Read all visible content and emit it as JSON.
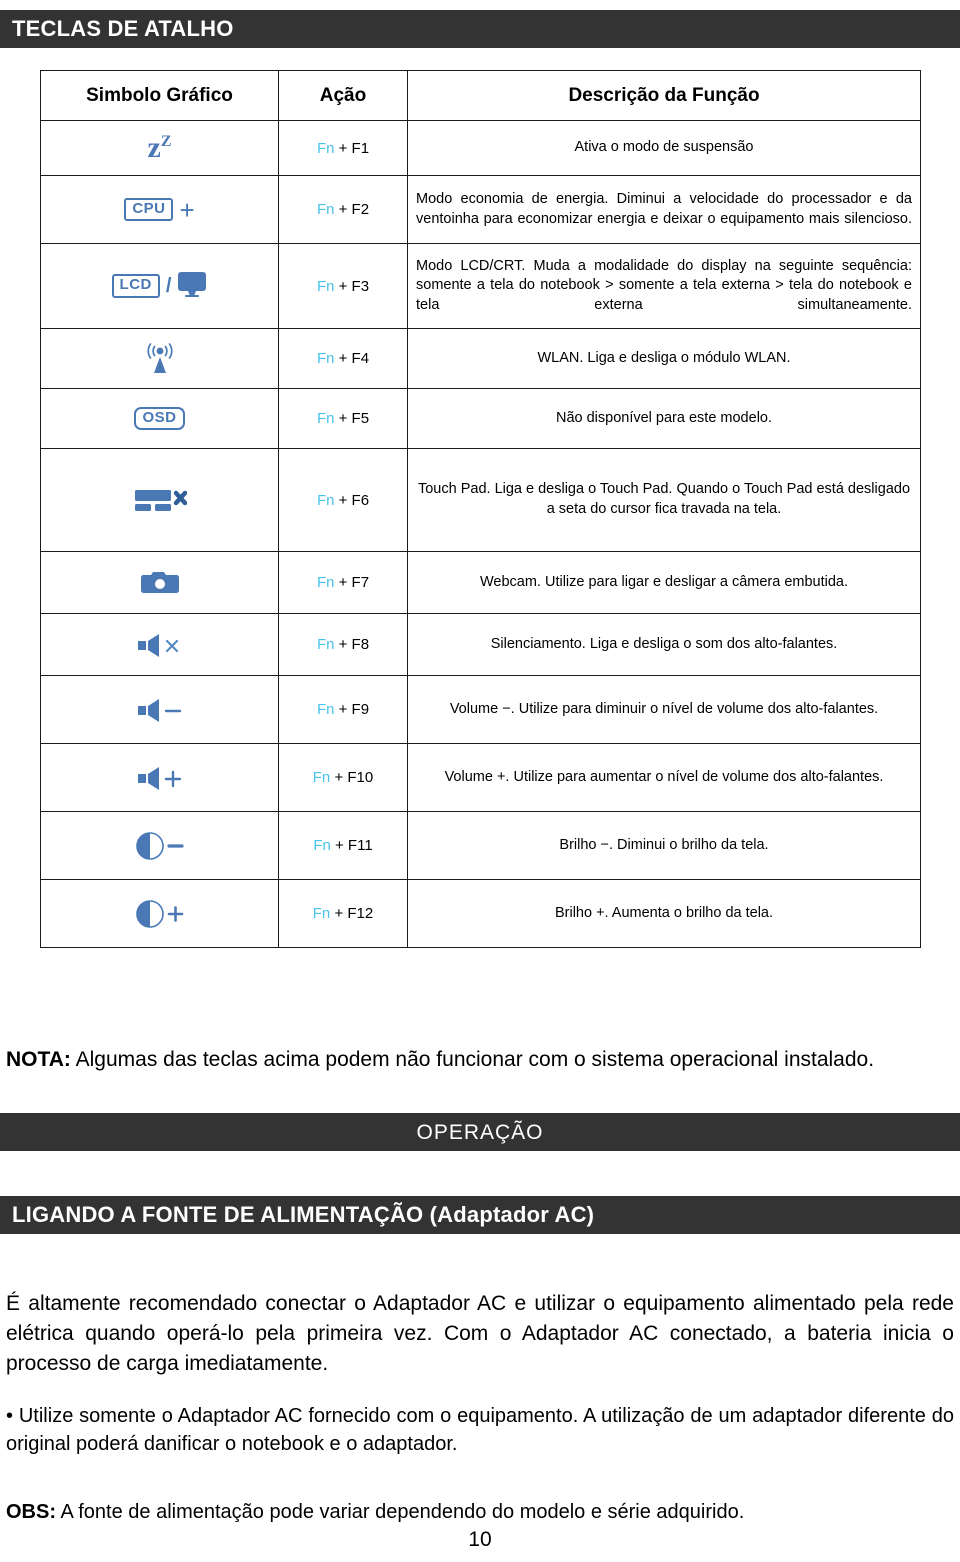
{
  "sections": {
    "top_bar_title": "TECLAS DE ATALHO",
    "operacao_bar_title": "OPERAÇÃO",
    "ligando_bar_title": "LIGANDO A FONTE DE ALIMENTAÇÃO (Adaptador AC)"
  },
  "table": {
    "headers": {
      "symbol": "Simbolo Gráfico",
      "action": "Ação",
      "description": "Descrição da Função"
    },
    "rows": [
      {
        "icon": "sleep-zz-icon",
        "fn": "Fn",
        "key": " + F1",
        "description": "Ativa o modo de suspensão"
      },
      {
        "icon": "cpu-plus-icon",
        "fn": "Fn",
        "key": " + F2",
        "description": "Modo economia de energia. Diminui a velocidade do processador e da ventoinha para economizar energia e deixar o equipamento mais silencioso."
      },
      {
        "icon": "lcd-monitor-icon",
        "fn": "Fn",
        "key": " + F3",
        "description": "Modo LCD/CRT. Muda a modalidade do display na seguinte sequência: somente a tela do notebook > somente a tela externa > tela do notebook e tela externa simultaneamente."
      },
      {
        "icon": "wlan-antenna-icon",
        "fn": "Fn",
        "key": " + F4",
        "description": "WLAN. Liga e desliga o módulo WLAN."
      },
      {
        "icon": "osd-icon",
        "fn": "Fn",
        "key": " + F5",
        "description": "Não disponível para este modelo."
      },
      {
        "icon": "touchpad-off-icon",
        "fn": "Fn",
        "key": " + F6",
        "description": "Touch Pad. Liga e desliga o Touch Pad. Quando o Touch Pad está desligado a seta do cursor fica travada na tela."
      },
      {
        "icon": "webcam-camera-icon",
        "fn": "Fn",
        "key": " + F7",
        "description": "Webcam. Utilize para ligar e desligar a câmera embutida."
      },
      {
        "icon": "speaker-mute-icon",
        "fn": "Fn",
        "key": " + F8",
        "description": "Silenciamento. Liga e desliga o som dos alto-falantes."
      },
      {
        "icon": "speaker-volume-down-icon",
        "fn": "Fn",
        "key": " + F9",
        "description": "Volume −. Utilize para diminuir o nível de volume dos alto-falantes."
      },
      {
        "icon": "speaker-volume-up-icon",
        "fn": "Fn",
        "key": " + F10",
        "description": "Volume +. Utilize para aumentar o nível de volume dos alto-falantes."
      },
      {
        "icon": "brightness-down-icon",
        "fn": "Fn",
        "key": " + F11",
        "description": "Brilho −. Diminui o brilho da tela."
      },
      {
        "icon": "brightness-up-icon",
        "fn": "Fn",
        "key": " + F12",
        "description": "Brilho +. Aumenta o brilho da tela."
      }
    ],
    "icon_labels": {
      "cpu": "CPU",
      "lcd": "LCD",
      "osd": "OSD",
      "zz_base": "z",
      "zz_sup": "Z",
      "plus": "+",
      "minus": "−",
      "slash": "/",
      "times": "✕"
    }
  },
  "notes": {
    "nota_label": "NOTA:",
    "nota_text": " Algumas das teclas acima podem não funcionar com o sistema operacional instalado."
  },
  "body": {
    "intro_paragraph": "É altamente recomendado conectar o Adaptador AC e utilizar o equipamento alimentado pela rede elétrica quando operá-lo pela primeira vez. Com o Adaptador AC conectado, a bateria inicia o processo de carga imediatamente.",
    "bullet_paragraph": "• Utilize somente o Adaptador AC fornecido com o equipamento. A utilização de um adaptador diferente do original poderá danificar o notebook e o adaptador.",
    "obs_label": "OBS:",
    "obs_text": " A fonte de alimentação pode variar dependendo do modelo e série adquirido."
  },
  "footer": {
    "page_number": "10"
  },
  "colors": {
    "bar_background": "#333333",
    "bar_text": "#ffffff",
    "icon_blue": "#4a78b5",
    "fn_cyan": "#48c4e8",
    "table_border": "#1a1a1a",
    "page_background": "#ffffff"
  }
}
